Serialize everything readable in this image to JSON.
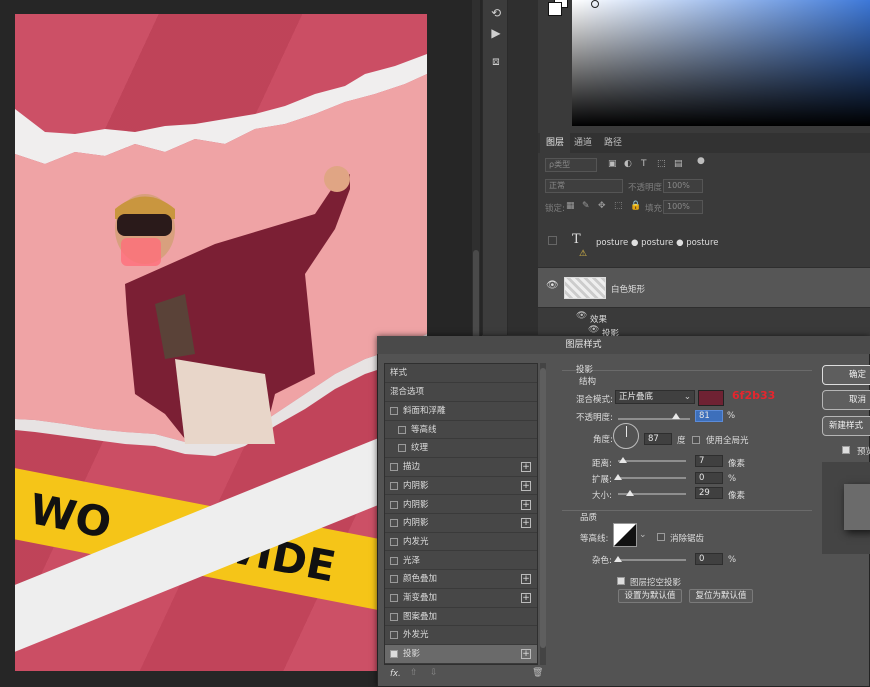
{
  "toolstrip": {
    "icons": [
      "history-icon",
      "play-icon",
      "3d-icon"
    ]
  },
  "color_panel": {
    "accent": "#3d78d8",
    "fg": "#ffffff",
    "bg": "#ffffff"
  },
  "layers": {
    "tabs": [
      "图层",
      "通道",
      "路径"
    ],
    "kind_filter": "ρ类型",
    "blend_mode": "正常",
    "opacity_label": "不透明度:",
    "opacity_value": "100%",
    "lock_label": "锁定:",
    "fill_label": "填充:",
    "fill_value": "100%",
    "text_layer_name": "posture ● posture ● posture",
    "text_layer_glyph": "T",
    "rect_layer_name": "白色矩形",
    "effects_label": "效果",
    "effect_item": "投影"
  },
  "poster": {
    "background": "#c9475e",
    "banner_left": "WO",
    "banner_right": "DWIDE",
    "banner_color": "#f5c518"
  },
  "dialog": {
    "title": "图层样式",
    "styles_header": "样式",
    "blend_options": "混合选项",
    "style_items": [
      {
        "label": "斜面和浮雕",
        "checked": false,
        "plus": false,
        "indent": false
      },
      {
        "label": "等高线",
        "checked": false,
        "plus": false,
        "indent": true
      },
      {
        "label": "纹理",
        "checked": false,
        "plus": false,
        "indent": true
      },
      {
        "label": "描边",
        "checked": false,
        "plus": true,
        "indent": false
      },
      {
        "label": "内阴影",
        "checked": false,
        "plus": true,
        "indent": false
      },
      {
        "label": "内阴影",
        "checked": false,
        "plus": true,
        "indent": false
      },
      {
        "label": "内阴影",
        "checked": false,
        "plus": true,
        "indent": false
      },
      {
        "label": "内发光",
        "checked": false,
        "plus": false,
        "indent": false
      },
      {
        "label": "光泽",
        "checked": false,
        "plus": false,
        "indent": false
      },
      {
        "label": "颜色叠加",
        "checked": false,
        "plus": true,
        "indent": false
      },
      {
        "label": "渐变叠加",
        "checked": false,
        "plus": true,
        "indent": false
      },
      {
        "label": "图案叠加",
        "checked": false,
        "plus": false,
        "indent": false
      },
      {
        "label": "外发光",
        "checked": false,
        "plus": false,
        "indent": false
      },
      {
        "label": "投影",
        "checked": true,
        "plus": true,
        "indent": false
      }
    ],
    "fx_label": "fx.",
    "section_title": "投影",
    "structure_title": "结构",
    "blend_mode_label": "混合模式:",
    "blend_mode_value": "正片叠底",
    "shadow_color": "#6f2233",
    "shadow_color_hex_label": "6f2b33",
    "opacity_label": "不透明度:",
    "opacity_value": "81",
    "opacity_pct": 81,
    "angle_label": "角度:",
    "angle_value": "87",
    "angle_unit": "度",
    "global_light_label": "使用全局光",
    "distance_label": "距离:",
    "distance_value": "7",
    "distance_unit": "像素",
    "spread_label": "扩展:",
    "spread_value": "0",
    "spread_unit": "%",
    "size_label": "大小:",
    "size_value": "29",
    "size_unit": "像素",
    "quality_title": "品质",
    "contour_label": "等高线:",
    "antialias_label": "消除锯齿",
    "noise_label": "杂色:",
    "noise_value": "0",
    "noise_unit": "%",
    "knockout_label": "图层挖空投影",
    "make_default": "设置为默认值",
    "reset_default": "复位为默认值",
    "pct": "%",
    "buttons": {
      "ok": "确定",
      "cancel": "取消",
      "new_style": "新建样式",
      "preview": "预览"
    }
  }
}
